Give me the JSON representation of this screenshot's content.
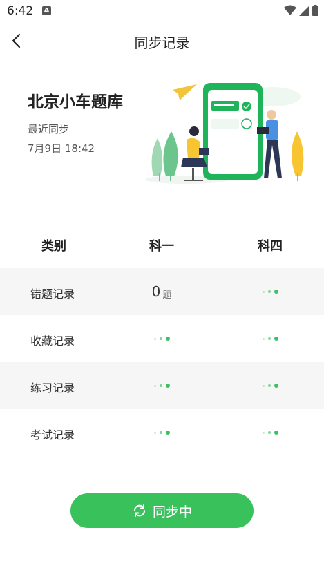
{
  "status_bar": {
    "time": "6:42",
    "notification_letter": "A"
  },
  "header": {
    "title": "同步记录"
  },
  "bank": {
    "title": "北京小车题库",
    "sync_label": "最近同步",
    "sync_time": "7月9日 18:42"
  },
  "table": {
    "headers": [
      "类别",
      "科一",
      "科四"
    ],
    "rows": [
      {
        "label": "错题记录",
        "k1": {
          "count": "0",
          "unit": "题"
        },
        "k4": "loading"
      },
      {
        "label": "收藏记录",
        "k1": "loading",
        "k4": "loading"
      },
      {
        "label": "练习记录",
        "k1": "loading",
        "k4": "loading"
      },
      {
        "label": "考试记录",
        "k1": "loading",
        "k4": "loading"
      }
    ]
  },
  "action": {
    "label": "同步中"
  },
  "colors": {
    "accent": "#39c15c",
    "row_alt": "#f6f6f6"
  }
}
